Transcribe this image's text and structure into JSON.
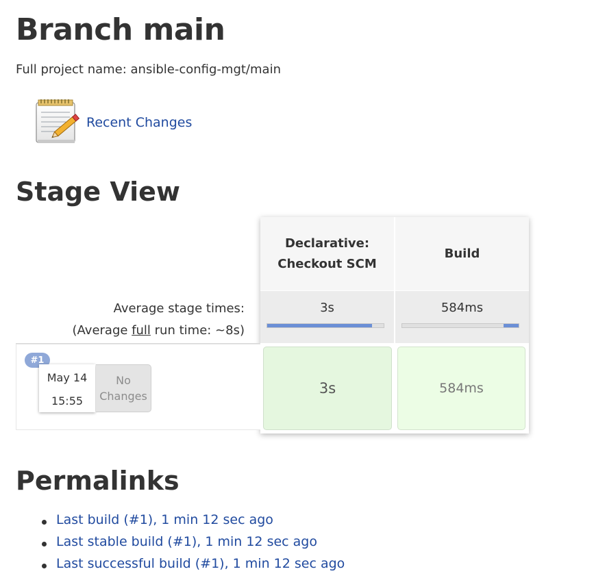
{
  "header": {
    "title": "Branch main",
    "full_name": "Full project name: ansible-config-mgt/main"
  },
  "recent_changes": {
    "label": "Recent Changes",
    "icon": "notepad-icon"
  },
  "stage_view": {
    "title": "Stage View",
    "columns": [
      "Declarative:\nCheckout SCM",
      "Build"
    ],
    "column_lines": [
      [
        "Declarative:",
        "Checkout SCM"
      ],
      [
        "Build"
      ]
    ],
    "avg_times_label": "Average stage times:",
    "avg_full_prefix": "(Average ",
    "avg_full_link": "full",
    "avg_full_suffix": " run time: ~8s)",
    "avg_values": [
      "3s",
      "584ms"
    ],
    "avg_bar_fraction": [
      0.9,
      0.13
    ],
    "runs": [
      {
        "badge": "#1",
        "date": "May 14",
        "time": "15:55",
        "changes": [
          "No",
          "Changes"
        ],
        "cells": [
          "3s",
          "584ms"
        ]
      }
    ],
    "colors": {
      "success_cell": "#e5f7df",
      "success_cell_light": "#ecfde5",
      "bar_fill": "#6b8fd6",
      "badge": "#8fa8d8"
    }
  },
  "permalinks": {
    "title": "Permalinks",
    "items": [
      "Last build (#1), 1 min 12 sec ago",
      "Last stable build (#1), 1 min 12 sec ago",
      "Last successful build (#1), 1 min 12 sec ago"
    ]
  },
  "link_color": "#204a9f"
}
